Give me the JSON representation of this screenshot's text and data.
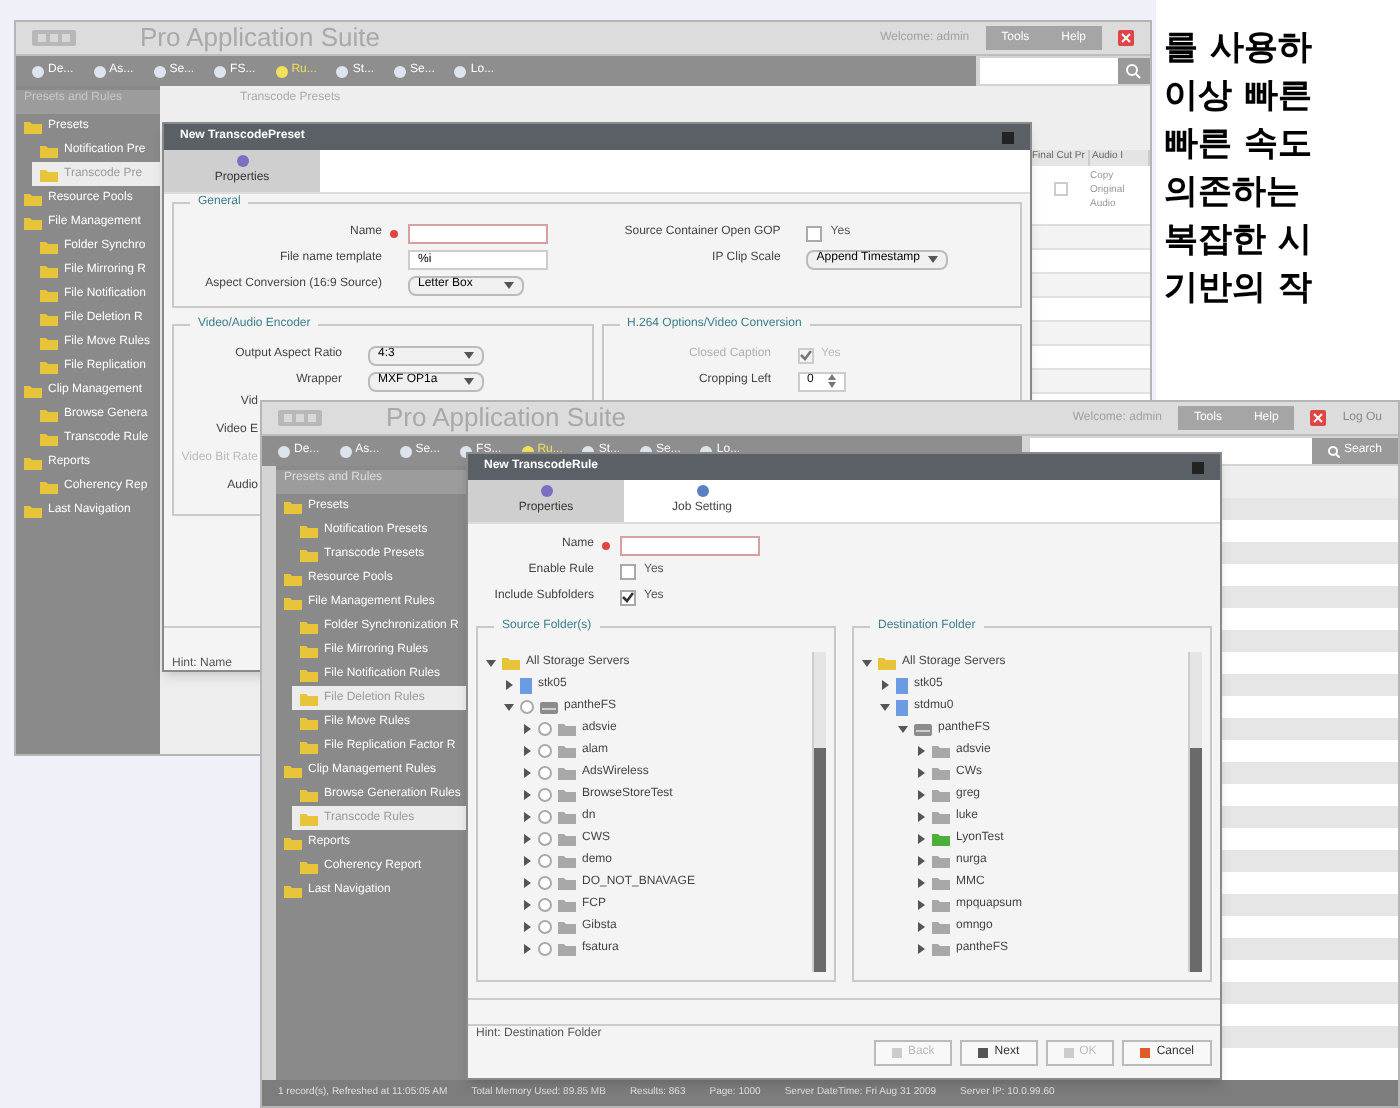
{
  "article": {
    "lines": [
      "를 사용하",
      "이상 빠른",
      "빠른 속도",
      "의존하는",
      "복잡한 시",
      "기반의 작"
    ]
  },
  "back_window": {
    "header": {
      "title": "Pro Application Suite",
      "welcome": "Welcome: admin",
      "buttons": [
        "Tools",
        "Help"
      ]
    },
    "toolbar": [
      {
        "label": "De...",
        "selected": false
      },
      {
        "label": "As...",
        "selected": false
      },
      {
        "label": "Se...",
        "selected": false
      },
      {
        "label": "FS...",
        "selected": false
      },
      {
        "label": "Ru...",
        "selected": true
      },
      {
        "label": "St...",
        "selected": false
      },
      {
        "label": "Se...",
        "selected": false
      },
      {
        "label": "Lo...",
        "selected": false
      }
    ],
    "sidebar": {
      "title": "Presets and Rules",
      "items": [
        {
          "label": "Presets",
          "selected": false,
          "children": [
            {
              "label": "Notification Pre",
              "selected": false
            },
            {
              "label": "Transcode Pre",
              "selected": true
            }
          ]
        },
        {
          "label": "Resource Pools",
          "selected": false
        },
        {
          "label": "File Management",
          "selected": false,
          "children": [
            {
              "label": "Folder Synchro",
              "selected": false
            },
            {
              "label": "File Mirroring R",
              "selected": false
            },
            {
              "label": "File Notification",
              "selected": false
            },
            {
              "label": "File Deletion R",
              "selected": false
            },
            {
              "label": "File Move Rules",
              "selected": false
            },
            {
              "label": "File Replication",
              "selected": false
            }
          ]
        },
        {
          "label": "Clip Management",
          "selected": false,
          "children": [
            {
              "label": "Browse Genera",
              "selected": false
            },
            {
              "label": "Transcode Rule",
              "selected": false
            }
          ]
        },
        {
          "label": "Reports",
          "selected": false,
          "children": [
            {
              "label": "Coherency Rep",
              "selected": false
            }
          ]
        },
        {
          "label": "Last Navigation",
          "selected": false
        }
      ]
    },
    "panel_title": "Transcode Presets",
    "grid": {
      "columns": [
        "Final Cut Pr",
        "Audio I"
      ],
      "rows": [
        {
          "checked": false,
          "cell": "Copy Original Audio"
        }
      ]
    },
    "dialog": {
      "title": "New TranscodePreset",
      "tabs": [
        {
          "label": "Properties",
          "selected": true
        }
      ],
      "general": {
        "legend": "General",
        "left": [
          {
            "kind": "text",
            "label": "Name",
            "required": true
          },
          {
            "kind": "text",
            "label": "File name template",
            "value": "%i"
          },
          {
            "kind": "select",
            "label": "Aspect Conversion (16:9 Source)",
            "value": "Letter Box"
          }
        ],
        "right": [
          {
            "kind": "checkbox",
            "label": "Source Container Open GOP",
            "value": "Yes",
            "checked": false,
            "disabled": false
          },
          {
            "kind": "select",
            "label": "IP Clip Scale",
            "value": "Append Timestamp"
          }
        ]
      },
      "encoder": {
        "legend": "Video/Audio Encoder",
        "fields": [
          {
            "kind": "select",
            "label": "Output Aspect Ratio",
            "value": "4:3"
          },
          {
            "kind": "select",
            "label": "Wrapper",
            "value": "MXF OP1a"
          }
        ],
        "partial_labels": [
          "Vid",
          "Video E",
          "Video Bit Rate",
          "Audio"
        ]
      },
      "options": {
        "legend": "H.264 Options/Video Conversion",
        "fields": [
          {
            "kind": "checkbox",
            "label": "Closed Caption",
            "value": "Yes",
            "checked": true,
            "disabled": true
          },
          {
            "kind": "spinner",
            "label": "Cropping Left",
            "value": "0"
          }
        ]
      },
      "hint": "Hint: Name"
    }
  },
  "front_window": {
    "header": {
      "title": "Pro Application Suite",
      "welcome": "Welcome: admin",
      "buttons": [
        "Tools",
        "Help"
      ],
      "logout": "Log Ou",
      "search": "Search"
    },
    "toolbar": [
      {
        "label": "De...",
        "selected": false
      },
      {
        "label": "As...",
        "selected": false
      },
      {
        "label": "Se...",
        "selected": false
      },
      {
        "label": "FS...",
        "selected": false
      },
      {
        "label": "Ru...",
        "selected": true
      },
      {
        "label": "St...",
        "selected": false
      },
      {
        "label": "Se...",
        "selected": false
      },
      {
        "label": "Lo...",
        "selected": false
      }
    ],
    "sidebar": {
      "title": "Presets and Rules",
      "items": [
        {
          "label": "Presets",
          "selected": false,
          "children": [
            {
              "label": "Notification Presets",
              "selected": false
            },
            {
              "label": "Transcode Presets",
              "selected": false
            }
          ]
        },
        {
          "label": "Resource Pools",
          "selected": false
        },
        {
          "label": "File Management Rules",
          "selected": false,
          "children": [
            {
              "label": "Folder Synchronization R",
              "selected": false
            },
            {
              "label": "File Mirroring Rules",
              "selected": false
            },
            {
              "label": "File Notification Rules",
              "selected": false
            },
            {
              "label": "File Deletion Rules",
              "selected": true
            },
            {
              "label": "File Move Rules",
              "selected": false
            },
            {
              "label": "File Replication Factor R",
              "selected": false
            }
          ]
        },
        {
          "label": "Clip Management Rules",
          "selected": false,
          "children": [
            {
              "label": "Browse Generation Rules",
              "selected": false
            },
            {
              "label": "Transcode Rules",
              "selected": true
            }
          ]
        },
        {
          "label": "Reports",
          "selected": false,
          "children": [
            {
              "label": "Coherency Report",
              "selected": false
            }
          ]
        },
        {
          "label": "Last Navigation",
          "selected": false
        }
      ]
    },
    "dialog": {
      "title": "New TranscodeRule",
      "tabs": [
        {
          "label": "Properties",
          "selected": true
        },
        {
          "label": "Job Setting",
          "selected": false
        }
      ],
      "fields": [
        {
          "kind": "text",
          "label": "Name",
          "required": true
        },
        {
          "kind": "checkbox",
          "label": "Enable Rule",
          "value": "Yes",
          "checked": false,
          "disabled": false
        },
        {
          "kind": "checkbox",
          "label": "Include Subfolders",
          "value": "Yes",
          "checked": true,
          "disabled": false
        }
      ],
      "source": {
        "legend": "Source Folder(s)",
        "tree": [
          {
            "kind": "group",
            "label": "All Storage Servers",
            "expanded": true,
            "children": [
              {
                "kind": "server",
                "label": "stk05",
                "expanded": false
              },
              {
                "kind": "share",
                "label": "pantheFS",
                "expanded": true,
                "checked": false,
                "children": [
                  {
                    "kind": "folder",
                    "label": "adsvie",
                    "checked": false
                  },
                  {
                    "kind": "folder",
                    "label": "alam",
                    "checked": false
                  },
                  {
                    "kind": "folder",
                    "label": "AdsWireless",
                    "checked": false
                  },
                  {
                    "kind": "folder",
                    "label": "BrowseStoreTest",
                    "checked": false
                  },
                  {
                    "kind": "folder",
                    "label": "dn",
                    "checked": false
                  },
                  {
                    "kind": "folder",
                    "label": "CWS",
                    "checked": false
                  },
                  {
                    "kind": "folder",
                    "label": "demo",
                    "checked": false
                  },
                  {
                    "kind": "folder",
                    "label": "DO_NOT_BNAVAGE",
                    "checked": false
                  },
                  {
                    "kind": "folder",
                    "label": "FCP",
                    "checked": false
                  },
                  {
                    "kind": "folder",
                    "label": "Gibsta",
                    "checked": false
                  },
                  {
                    "kind": "folder",
                    "label": "fsatura",
                    "checked": false
                  }
                ]
              }
            ]
          }
        ]
      },
      "destination": {
        "legend": "Destination Folder",
        "tree": [
          {
            "kind": "group",
            "label": "All Storage Servers",
            "expanded": true,
            "children": [
              {
                "kind": "server",
                "label": "stk05",
                "expanded": false
              },
              {
                "kind": "server",
                "label": "stdmu0",
                "expanded": true,
                "children": [
                  {
                    "kind": "share",
                    "label": "pantheFS",
                    "expanded": true,
                    "children": [
                      {
                        "kind": "dest",
                        "label": "adsvie",
                        "checked": false
                      },
                      {
                        "kind": "dest",
                        "label": "CWs",
                        "checked": false
                      },
                      {
                        "kind": "dest",
                        "label": "greg",
                        "checked": false
                      },
                      {
                        "kind": "dest",
                        "label": "luke",
                        "checked": false
                      },
                      {
                        "kind": "dest",
                        "label": "LyonTest",
                        "checked": true
                      },
                      {
                        "kind": "dest",
                        "label": "nurga",
                        "checked": false
                      },
                      {
                        "kind": "dest",
                        "label": "MMC",
                        "checked": false
                      },
                      {
                        "kind": "dest",
                        "label": "mpquapsum",
                        "checked": false
                      },
                      {
                        "kind": "dest",
                        "label": "omngo",
                        "checked": false
                      },
                      {
                        "kind": "dest",
                        "label": "pantheFS",
                        "checked": false
                      }
                    ]
                  }
                ]
              }
            ]
          }
        ]
      },
      "hint": "Hint: Destination Folder",
      "buttons": [
        {
          "label": "Back",
          "disabled": true
        },
        {
          "label": "Next",
          "disabled": false
        },
        {
          "label": "OK",
          "disabled": true
        },
        {
          "label": "Cancel",
          "disabled": false
        }
      ]
    },
    "status_bar": [
      "1 record(s), Refreshed at 11:05:05 AM",
      "Total Memory Used: 89.85 MB",
      "Results: 863",
      "Page: 1000",
      "Server DateTime: Fri Aug 31 2009",
      "Server IP: 10.0.99.60"
    ]
  }
}
